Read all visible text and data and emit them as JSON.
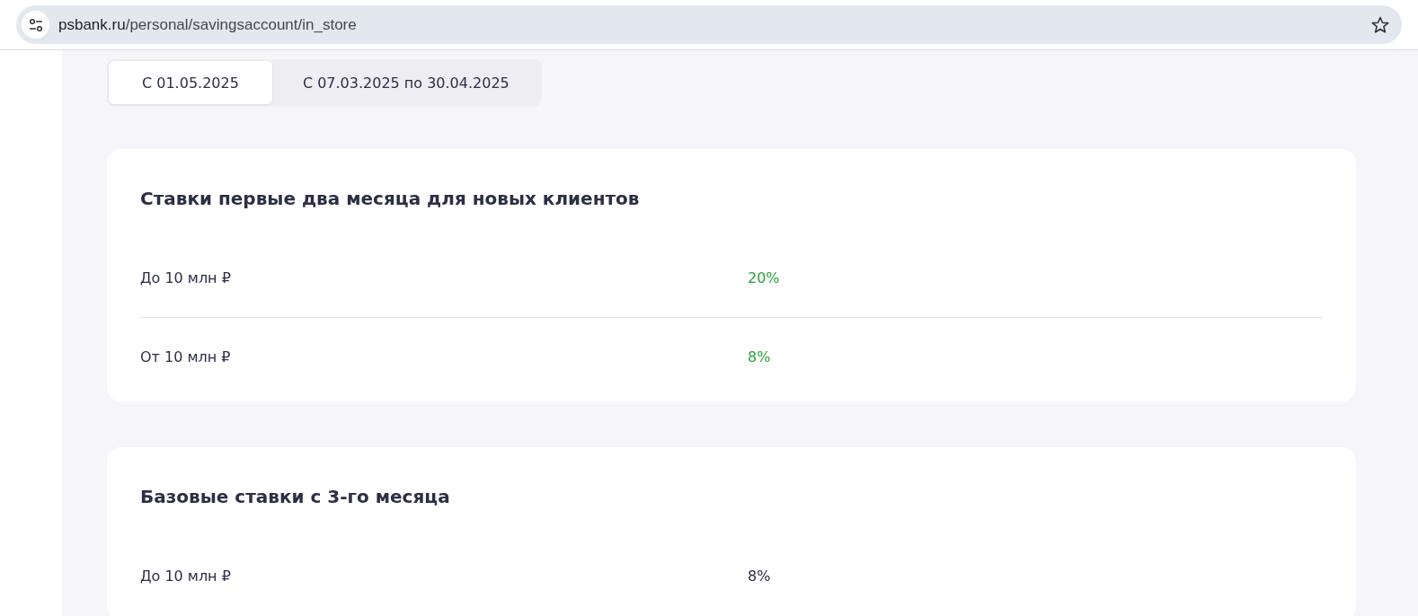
{
  "browser": {
    "url_host": "psbank.ru",
    "url_path": "/personal/savingsaccount/in_store"
  },
  "tabs": [
    {
      "label": "С 01.05.2025",
      "selected": true
    },
    {
      "label": "С 07.03.2025 по 30.04.2025",
      "selected": false
    }
  ],
  "sections": [
    {
      "title": "Ставки первые два месяца для новых клиентов",
      "rows": [
        {
          "amount": "До 10 млн ₽",
          "rate": "20%",
          "highlighted": true
        },
        {
          "amount": "От 10 млн ₽",
          "rate": "8%",
          "highlighted": true
        }
      ]
    },
    {
      "title": "Базовые ставки с 3-го месяца",
      "rows": [
        {
          "amount": "До 10 млн ₽",
          "rate": "8%",
          "highlighted": false
        }
      ]
    }
  ]
}
